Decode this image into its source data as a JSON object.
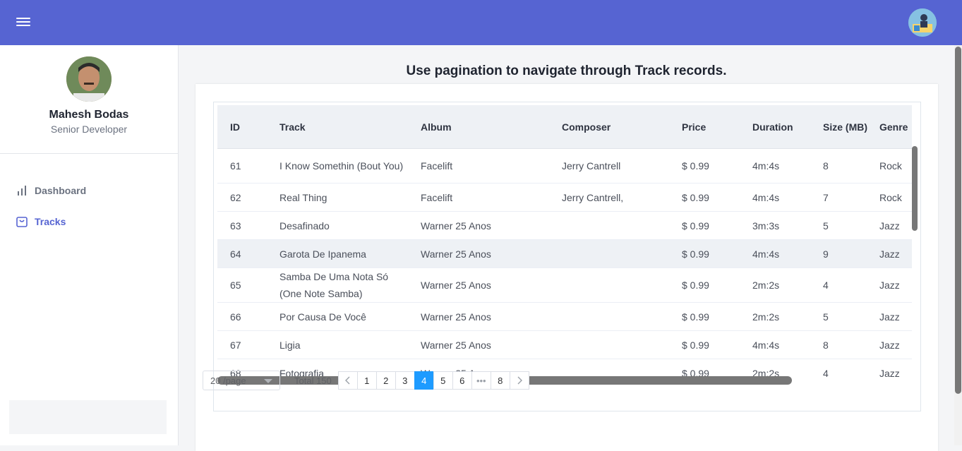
{
  "header": {
    "menu_icon": "hamburger-icon",
    "avatar_icon": "user-avatar-icon",
    "color": "#5664d2"
  },
  "sidebar": {
    "user_name": "Mahesh Bodas",
    "user_role": "Senior Developer",
    "items": [
      {
        "label": "Dashboard",
        "icon": "bar-chart-icon",
        "active": false
      },
      {
        "label": "Tracks",
        "icon": "shopping-bag-icon",
        "active": true
      }
    ]
  },
  "main": {
    "title": "Use pagination to navigate through Track records."
  },
  "table": {
    "columns": [
      "ID",
      "Track",
      "Album",
      "Composer",
      "Price",
      "Duration",
      "Size (MB)",
      "Genre"
    ],
    "rows": [
      {
        "id": "61",
        "track": "I Know Somethin (Bout You)",
        "album": "Facelift",
        "composer": "Jerry Cantrell",
        "price": "$ 0.99",
        "duration": "4m:4s",
        "size": "8",
        "genre": "Rock"
      },
      {
        "id": "62",
        "track": "Real Thing",
        "album": "Facelift",
        "composer": "Jerry Cantrell,",
        "price": "$ 0.99",
        "duration": "4m:4s",
        "size": "7",
        "genre": "Rock"
      },
      {
        "id": "63",
        "track": "Desafinado",
        "album": "Warner 25 Anos",
        "composer": "",
        "price": "$ 0.99",
        "duration": "3m:3s",
        "size": "5",
        "genre": "Jazz"
      },
      {
        "id": "64",
        "track": "Garota De Ipanema",
        "album": "Warner 25 Anos",
        "composer": "",
        "price": "$ 0.99",
        "duration": "4m:4s",
        "size": "9",
        "genre": "Jazz"
      },
      {
        "id": "65",
        "track": "Samba De Uma Nota Só (One Note Samba)",
        "album": "Warner 25 Anos",
        "composer": "",
        "price": "$ 0.99",
        "duration": "2m:2s",
        "size": "4",
        "genre": "Jazz"
      },
      {
        "id": "66",
        "track": "Por Causa De Você",
        "album": "Warner 25 Anos",
        "composer": "",
        "price": "$ 0.99",
        "duration": "2m:2s",
        "size": "5",
        "genre": "Jazz"
      },
      {
        "id": "67",
        "track": "Ligia",
        "album": "Warner 25 Anos",
        "composer": "",
        "price": "$ 0.99",
        "duration": "4m:4s",
        "size": "8",
        "genre": "Jazz"
      },
      {
        "id": "68",
        "track": "Fotografia",
        "album": "Warner 25 Anos",
        "composer": "",
        "price": "$ 0.99",
        "duration": "2m:2s",
        "size": "4",
        "genre": "Jazz"
      }
    ]
  },
  "pagination": {
    "page_size": "20 /page",
    "total": "Total 150",
    "pages": [
      "1",
      "2",
      "3",
      "4",
      "5",
      "6",
      "•••",
      "8"
    ],
    "current": "4"
  }
}
